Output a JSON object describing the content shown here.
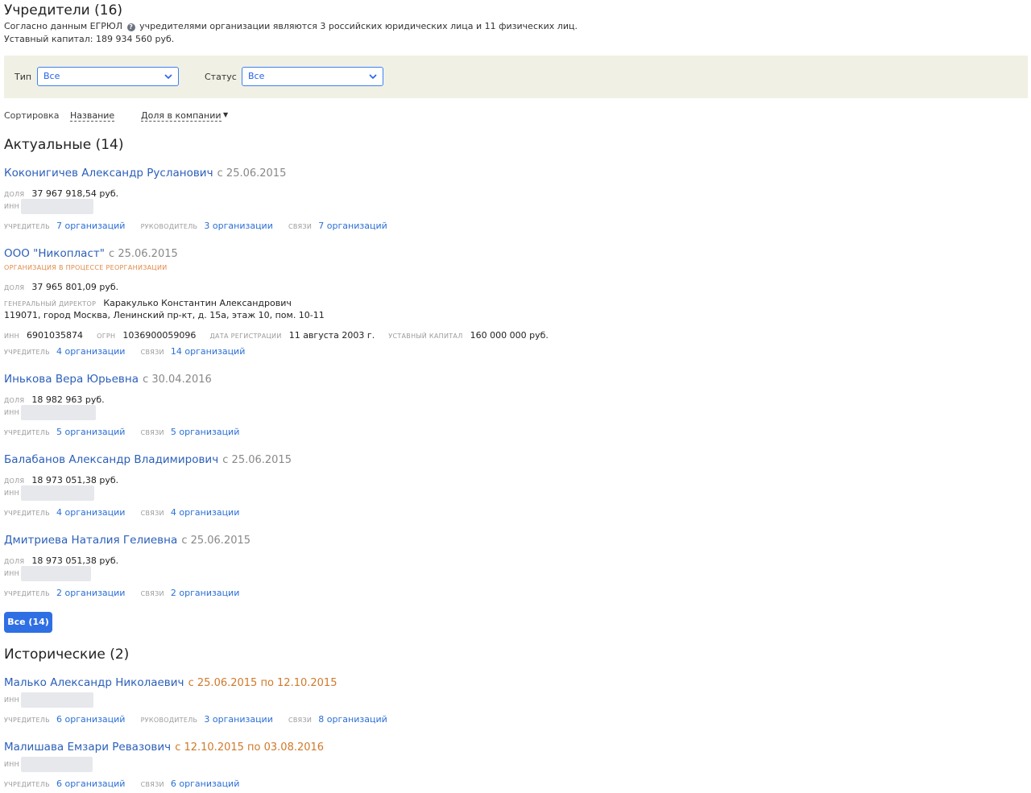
{
  "header": {
    "title": "Учредители (16)",
    "info_prefix": "Согласно данным ЕГРЮЛ",
    "info_icon": "question-icon",
    "info_suffix": "учредителями организации являются 3 российских юридических лица и 11 физических лиц.",
    "capital": "Уставный капитал: 189 934 560 руб."
  },
  "filters": {
    "type_label": "Тип",
    "type_value": "Все",
    "status_label": "Статус",
    "status_value": "Все"
  },
  "sort": {
    "label": "Сортировка",
    "by_name": "Название",
    "by_share": "Доля в компании",
    "arrow": "▼"
  },
  "current": {
    "title": "Актуальные (14)",
    "items": [
      {
        "name": "Коконигичев Александр Русланович",
        "since": "с 25.06.2015",
        "share_label": "доля",
        "share": "37 967 918,54 руб.",
        "inn_label": "инн",
        "l1_label": "учредитель",
        "l1": "7 организаций",
        "l2_label": "руководитель",
        "l2": "3 организации",
        "l3_label": "связи",
        "l3": "7 организаций"
      },
      {
        "name": "ООО \"Никопласт\"",
        "since": "с 25.06.2015",
        "status": "организация в процессе реорганизации",
        "share_label": "доля",
        "share": "37 965 801,09 руб.",
        "director_label": "генеральный директор",
        "director": "Каракулько Константин Александрович",
        "address": "119071, город Москва, Ленинский пр-кт, д. 15а, этаж 10, пом. 10-11",
        "inn_label": "инн",
        "inn": "6901035874",
        "ogrn_label": "огрн",
        "ogrn": "1036900059096",
        "reg_label": "дата регистрации",
        "reg": "11 августа 2003 г.",
        "cap_label": "уставный капитал",
        "cap": "160 000 000 руб.",
        "l1_label": "учредитель",
        "l1": "4 организации",
        "l3_label": "связи",
        "l3": "14 организаций"
      },
      {
        "name": "Инькова Вера Юрьевна",
        "since": "с 30.04.2016",
        "share_label": "доля",
        "share": "18 982 963 руб.",
        "inn_label": "инн",
        "l1_label": "учредитель",
        "l1": "5 организаций",
        "l3_label": "связи",
        "l3": "5 организаций"
      },
      {
        "name": "Балабанов Александр Владимирович",
        "since": "с 25.06.2015",
        "share_label": "доля",
        "share": "18 973 051,38 руб.",
        "inn_label": "инн",
        "l1_label": "учредитель",
        "l1": "4 организации",
        "l3_label": "связи",
        "l3": "4 организации"
      },
      {
        "name": "Дмитриева Наталия Гелиевна",
        "since": "с 25.06.2015",
        "share_label": "доля",
        "share": "18 973 051,38 руб.",
        "inn_label": "инн",
        "l1_label": "учредитель",
        "l1": "2 организации",
        "l3_label": "связи",
        "l3": "2 организации"
      }
    ],
    "all_button": "Все (14)"
  },
  "historical": {
    "title": "Исторические (2)",
    "items": [
      {
        "name": "Малько Александр Николаевич",
        "since": "с 25.06.2015 по 12.10.2015",
        "inn_label": "инн",
        "l1_label": "учредитель",
        "l1": "6 организаций",
        "l2_label": "руководитель",
        "l2": "3 организации",
        "l3_label": "связи",
        "l3": "8 организаций"
      },
      {
        "name": "Малишава Емзари Ревазович",
        "since": "с 12.10.2015 по 03.08.2016",
        "inn_label": "инн",
        "l1_label": "учредитель",
        "l1": "6 организаций",
        "l3_label": "связи",
        "l3": "6 организаций"
      }
    ]
  },
  "colors": {
    "link": "#2b6fd6",
    "name": "#2b5fb9",
    "history_date": "#d0792a",
    "filter_bg": "#f1f0e4",
    "button": "#2f6fe4"
  }
}
